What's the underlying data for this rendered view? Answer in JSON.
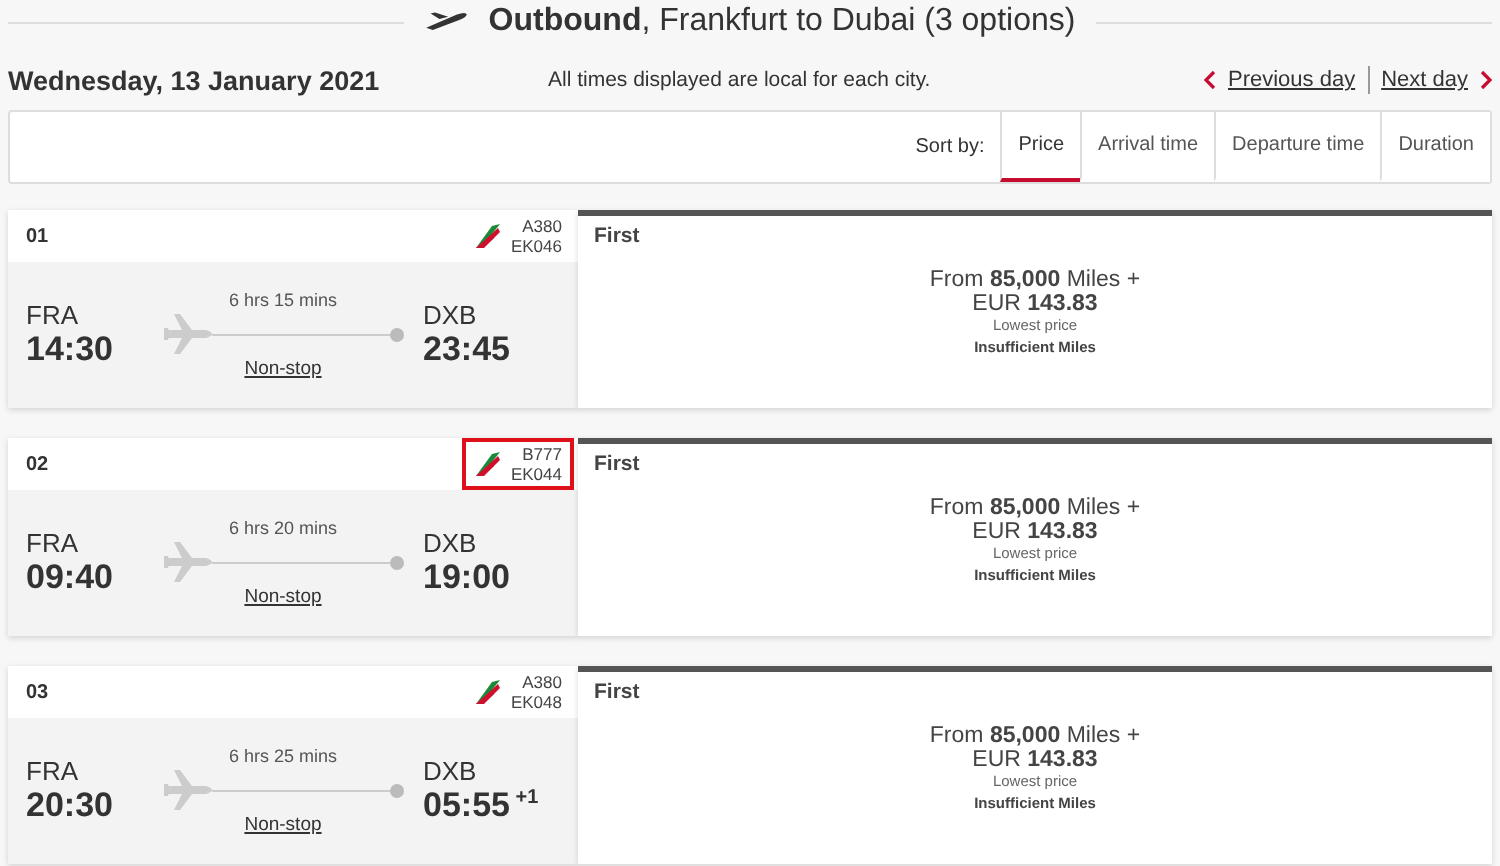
{
  "header": {
    "title_bold": "Outbound",
    "title_rest": ", Frankfurt to Dubai (3 options)"
  },
  "date": "Wednesday, 13 January 2021",
  "notice": "All times displayed are local for each city.",
  "day_nav": [
    {
      "label": "Previous day",
      "kind": "prev"
    },
    {
      "label": "Next day",
      "kind": "next"
    }
  ],
  "sort": {
    "label": "Sort by:",
    "options": [
      {
        "label": "Price",
        "selected": true
      },
      {
        "label": "Arrival time",
        "selected": false
      },
      {
        "label": "Departure time",
        "selected": false
      },
      {
        "label": "Duration",
        "selected": false
      }
    ]
  },
  "flights": [
    {
      "number": "01",
      "aircraft": "A380",
      "flight_code": "EK046",
      "highlighted": false,
      "origin": "FRA",
      "departure": "14:30",
      "duration": "6 hrs 15 mins",
      "stops": "Non-stop",
      "destination": "DXB",
      "arrival": "23:45",
      "cabin": "First",
      "price_line1": "From **85,000** Miles +",
      "price_line2": "EUR **143.83**",
      "price_note": "Lowest price",
      "status": "Insufficient Miles"
    },
    {
      "number": "02",
      "aircraft": "B777",
      "flight_code": "EK044",
      "highlighted": true,
      "origin": "FRA",
      "departure": "09:40",
      "duration": "6 hrs 20 mins",
      "stops": "Non-stop",
      "destination": "DXB",
      "arrival": "19:00",
      "cabin": "First",
      "price_line1": "From **85,000** Miles +",
      "price_line2": "EUR **143.83**",
      "price_note": "Lowest price",
      "status": "Insufficient Miles"
    },
    {
      "number": "03",
      "aircraft": "A380",
      "flight_code": "EK048",
      "highlighted": false,
      "origin": "FRA",
      "departure": "20:30",
      "duration": "6 hrs 25 mins",
      "stops": "Non-stop",
      "destination": "DXB",
      "arrival": "05:55",
      "day_offset": "+1",
      "cabin": "First",
      "price_line1": "From **85,000** Miles +",
      "price_line2": "EUR **143.83**",
      "price_note": "Lowest price",
      "status": "Insufficient Miles"
    }
  ]
}
